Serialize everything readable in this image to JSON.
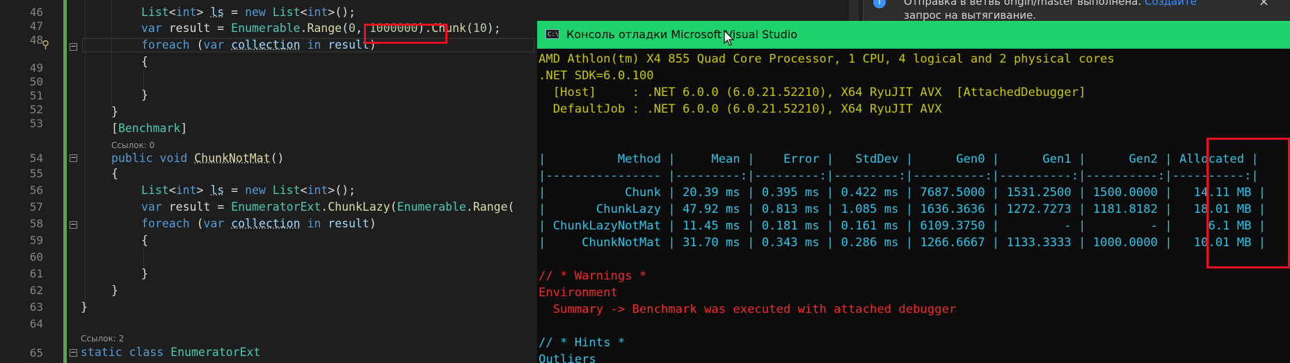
{
  "editor": {
    "line_numbers": [
      "46",
      "47",
      "48",
      "49",
      "50",
      "51",
      "52",
      "53",
      "54",
      "55",
      "56",
      "57",
      "58",
      "59",
      "60",
      "61",
      "62",
      "63",
      "64",
      "65"
    ],
    "codelens": {
      "refs_0": "Ссылок: 0",
      "refs_2": "Ссылок: 2"
    },
    "lines": {
      "l46": {
        "a": "List",
        "b": "<",
        "c": "int",
        "d": "> ",
        "e": "ls",
        "f": " = ",
        "g": "new",
        "h": " List",
        "i": "<",
        "j": "int",
        "k": ">();"
      },
      "l47": {
        "a": "var",
        "b": " result = ",
        "c": "Enumerable",
        "d": ".",
        "e": "Range",
        "f": "(",
        "g": "0",
        "h": ", ",
        "i": "1000000",
        "j": ").",
        "k": "Chunk",
        "l": "(",
        "m": "10",
        "n": ");"
      },
      "l48": {
        "a": "foreach",
        "b": " (",
        "c": "var",
        "d": " ",
        "e": "collection",
        "f": " ",
        "g": "in",
        "h": " ",
        "i": "result",
        "j": ")"
      },
      "l49": "{",
      "l51": "}",
      "l52": "}",
      "l53": {
        "a": "[",
        "b": "Benchmark",
        "c": "]"
      },
      "l54": {
        "a": "public",
        "b": " ",
        "c": "void",
        "d": " ",
        "e": "ChunkNotMat",
        "f": "()"
      },
      "l55": "{",
      "l56": {
        "a": "List",
        "b": "<",
        "c": "int",
        "d": "> ",
        "e": "ls",
        "f": " = ",
        "g": "new",
        "h": " List",
        "i": "<",
        "j": "int",
        "k": ">();"
      },
      "l57": {
        "a": "var",
        "b": " result = ",
        "c": "EnumeratorExt",
        "d": ".",
        "e": "ChunkLazy",
        "f": "(",
        "g": "Enumerable",
        "h": ".",
        "i": "Range",
        "j": "("
      },
      "l58": {
        "a": "foreach",
        "b": " (",
        "c": "var",
        "d": " ",
        "e": "collection",
        "f": " ",
        "g": "in",
        "h": " ",
        "i": "result",
        "j": ")"
      },
      "l59": "{",
      "l61": "}",
      "l62": "}",
      "l63": "}",
      "l65": {
        "a": "static",
        "b": " ",
        "c": "class",
        "d": " ",
        "e": "EnumeratorExt"
      }
    }
  },
  "notification": {
    "text": "Отправка в ветвь origin/master выполнена. ",
    "link": "Создайте",
    "text2": "запрос на вытягивание.",
    "close": "×"
  },
  "console": {
    "icon_text": "C:\\",
    "title": "Консоль отладки Microsoft Visual Studio",
    "env": [
      "AMD Athlon(tm) X4 855 Quad Core Processor, 1 CPU, 4 logical and 2 physical cores",
      ".NET SDK=6.0.100",
      "  [Host]     : .NET 6.0.0 (6.0.21.52210), X64 RyuJIT AVX  [AttachedDebugger]",
      "  DefaultJob : .NET 6.0.0 (6.0.21.52210), X64 RyuJIT AVX"
    ],
    "table": {
      "columns": [
        "Method",
        "Mean",
        "Error",
        "StdDev",
        "Gen0",
        "Gen1",
        "Gen2",
        "Allocated"
      ],
      "header_line": "|          Method |     Mean |    Error |   StdDev |      Gen0 |      Gen1 |      Gen2 | Allocated |",
      "separator_line": "|---------------- |---------:|---------:|---------:|----------:|----------:|----------:|----------:|",
      "rows": [
        {
          "line": "|           Chunk | 20.39 ms | 0.395 ms | 0.422 ms | 7687.5000 | 1531.2500 | 1500.0000 |   14.11 MB |",
          "cells": [
            "Chunk",
            "20.39 ms",
            "0.395 ms",
            "0.422 ms",
            "7687.5000",
            "1531.2500",
            "1500.0000",
            "14.11 MB"
          ]
        },
        {
          "line": "|       ChunkLazy | 47.92 ms | 0.813 ms | 1.085 ms | 1636.3636 | 1272.7273 | 1181.8182 |   18.01 MB |",
          "cells": [
            "ChunkLazy",
            "47.92 ms",
            "0.813 ms",
            "1.085 ms",
            "1636.3636",
            "1272.7273",
            "1181.8182",
            "18.01 MB"
          ]
        },
        {
          "line": "| ChunkLazyNotMat | 11.45 ms | 0.181 ms | 0.161 ms | 6109.3750 |         - |         - |     6.1 MB |",
          "cells": [
            "ChunkLazyNotMat",
            "11.45 ms",
            "0.181 ms",
            "0.161 ms",
            "6109.3750",
            "-",
            "-",
            "6.1 MB"
          ]
        },
        {
          "line": "|     ChunkNotMat | 31.70 ms | 0.343 ms | 0.286 ms | 1266.6667 | 1133.3333 | 1000.0000 |   10.01 MB |",
          "cells": [
            "ChunkNotMat",
            "31.70 ms",
            "0.343 ms",
            "0.286 ms",
            "1266.6667",
            "1133.3333",
            "1000.0000",
            "10.01 MB"
          ]
        }
      ]
    },
    "warnings": {
      "header": "// * Warnings *",
      "category": "Environment",
      "message": "  Summary -> Benchmark was executed with attached debugger"
    },
    "hints": {
      "header": "// * Hints *",
      "item": "Outliers"
    }
  },
  "colors": {
    "editor_bg": "#1e1e1e",
    "keyword": "#569cd6",
    "type": "#4ec9b0",
    "console_title": "#1ed36b",
    "console_env": "#c8c800",
    "console_table": "#2ec5e8",
    "console_warning": "#f22b2b",
    "highlight_box": "#e81123"
  }
}
